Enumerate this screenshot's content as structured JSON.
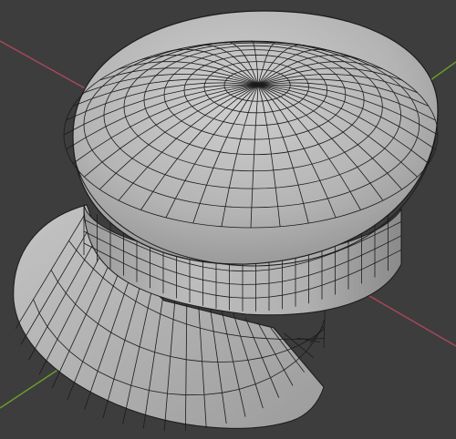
{
  "viewport": {
    "background": "#3d3d3d",
    "mesh_fill": "#a9a9a9",
    "mesh_light": "#c6c6c6",
    "mesh_shadow": "#7b7b7b",
    "wire_color": "#1b1b1b",
    "axis_x_color": "#a8475a",
    "axis_y_color": "#6c9b2f"
  },
  "scene": {
    "object": "cap-mesh",
    "shading": "solid-with-wireframe"
  }
}
